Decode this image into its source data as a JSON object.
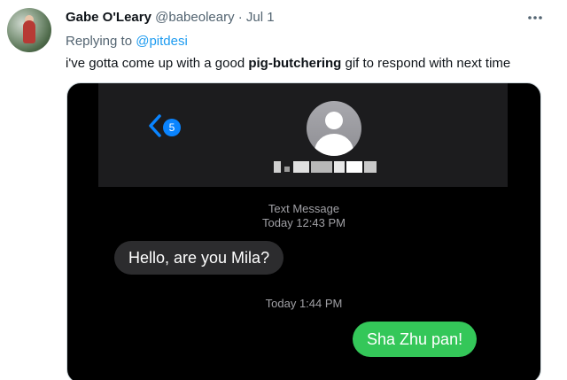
{
  "tweet": {
    "display_name": "Gabe O'Leary",
    "handle": "@babeoleary",
    "separator": "·",
    "date": "Jul 1",
    "more_icon": "more-horizontal-icon",
    "replying_prefix": "Replying to",
    "replying_handle": "@pitdesi",
    "text_before": "i've gotta come up with a good ",
    "text_bold": "pig-butchering",
    "text_after": " gif to respond with next time",
    "colors": {
      "link": "#1d9bf0",
      "secondary_text": "#536471",
      "primary_text": "#0f1419"
    }
  },
  "media": {
    "back_icon": "chevron-left-icon",
    "unread_badge": "5",
    "contact_avatar_icon": "person-silhouette-icon",
    "message_type": "Text Message",
    "timestamp_1": "Today 12:43 PM",
    "incoming_message": "Hello, are you Mila?",
    "timestamp_2": "Today 1:44 PM",
    "outgoing_message": "Sha Zhu pan!",
    "colors": {
      "outgoing_bubble": "#34c759",
      "incoming_bubble": "#2c2c2e",
      "ios_blue": "#0a84ff"
    }
  }
}
